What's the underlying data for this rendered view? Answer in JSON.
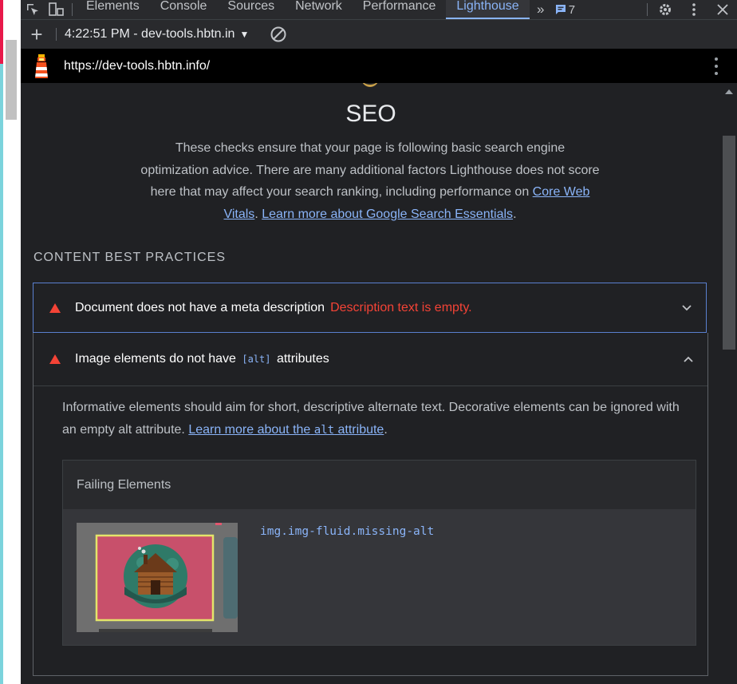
{
  "devtools": {
    "tabs": [
      {
        "label": "Elements",
        "active": false
      },
      {
        "label": "Console",
        "active": false
      },
      {
        "label": "Sources",
        "active": false
      },
      {
        "label": "Network",
        "active": false
      },
      {
        "label": "Performance",
        "active": false
      },
      {
        "label": "Lighthouse",
        "active": true
      }
    ],
    "more_tabs": "»",
    "issues_count": "7"
  },
  "lighthouse_toolbar": {
    "report": "4:22:51 PM - dev-tools.hbtn.in"
  },
  "url_bar": {
    "url": "https://dev-tools.hbtn.info/"
  },
  "seo": {
    "title": "SEO",
    "description": "These checks ensure that your page is following basic search engine optimization advice. There are many additional factors Lighthouse does not score here that may affect your search ranking, including performance on",
    "link_cwv": "Core Web Vitals",
    "sep": ". ",
    "link_learn": "Learn more about Google Search Essentials",
    "end": ".",
    "group_title": "CONTENT BEST PRACTICES"
  },
  "audits": [
    {
      "title": "Document does not have a meta description",
      "display_value": "Description text is empty.",
      "expanded": false
    },
    {
      "title_before": "Image elements do not have",
      "title_code": "[alt]",
      "title_after": "attributes",
      "expanded": true,
      "description": "Informative elements should aim for short, descriptive alternate text. Decorative elements can be ignored with an empty alt attribute.",
      "link_before": "Learn more about the",
      "link_code": "alt",
      "link_after": "attribute",
      "end": ".",
      "table_header": "Failing Elements",
      "failing_selector": "img.img-fluid.missing-alt"
    }
  ],
  "colors": {
    "accent": "#8ab4f8",
    "fail": "#f44336",
    "background": "#202124"
  }
}
